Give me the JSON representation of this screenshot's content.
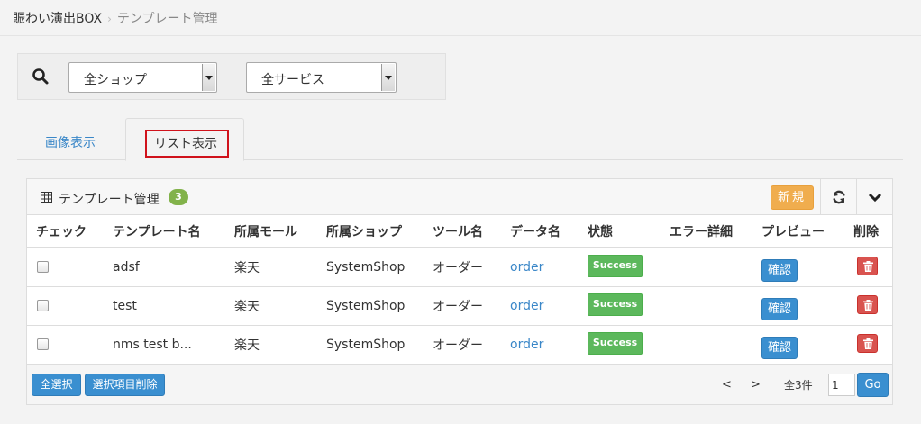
{
  "breadcrumb": {
    "root": "賑わい演出BOX",
    "separator": "›",
    "current": "テンプレート管理"
  },
  "filters": {
    "shop": "全ショップ",
    "service": "全サービス"
  },
  "tabs": {
    "image": "画像表示",
    "list": "リスト表示"
  },
  "panel": {
    "title": "テンプレート管理",
    "count": "3",
    "new_label": "新規"
  },
  "table": {
    "headers": [
      "チェック",
      "テンプレート名",
      "所属モール",
      "所属ショップ",
      "ツール名",
      "データ名",
      "状態",
      "エラー詳細",
      "プレビュー",
      "削除"
    ],
    "rows": [
      {
        "name": "adsf",
        "mall": "楽天",
        "shop": "SystemShop",
        "tool": "オーダー",
        "data": "order",
        "status": "Success",
        "error": "",
        "preview": "確認"
      },
      {
        "name": "test",
        "mall": "楽天",
        "shop": "SystemShop",
        "tool": "オーダー",
        "data": "order",
        "status": "Success",
        "error": "",
        "preview": "確認"
      },
      {
        "name": "nms test b...",
        "mall": "楽天",
        "shop": "SystemShop",
        "tool": "オーダー",
        "data": "order",
        "status": "Success",
        "error": "",
        "preview": "確認"
      }
    ]
  },
  "footer": {
    "select_all": "全選択",
    "delete_selected": "選択項目削除",
    "prev": "<",
    "next": ">",
    "total": "全3件",
    "page": "1",
    "go": "Go"
  },
  "colors": {
    "accent": "#3a8fd0",
    "success": "#5cb85c",
    "danger": "#d9534f",
    "warning": "#f0ad4e",
    "badge": "#82b24a",
    "highlight": "#d0121b"
  }
}
